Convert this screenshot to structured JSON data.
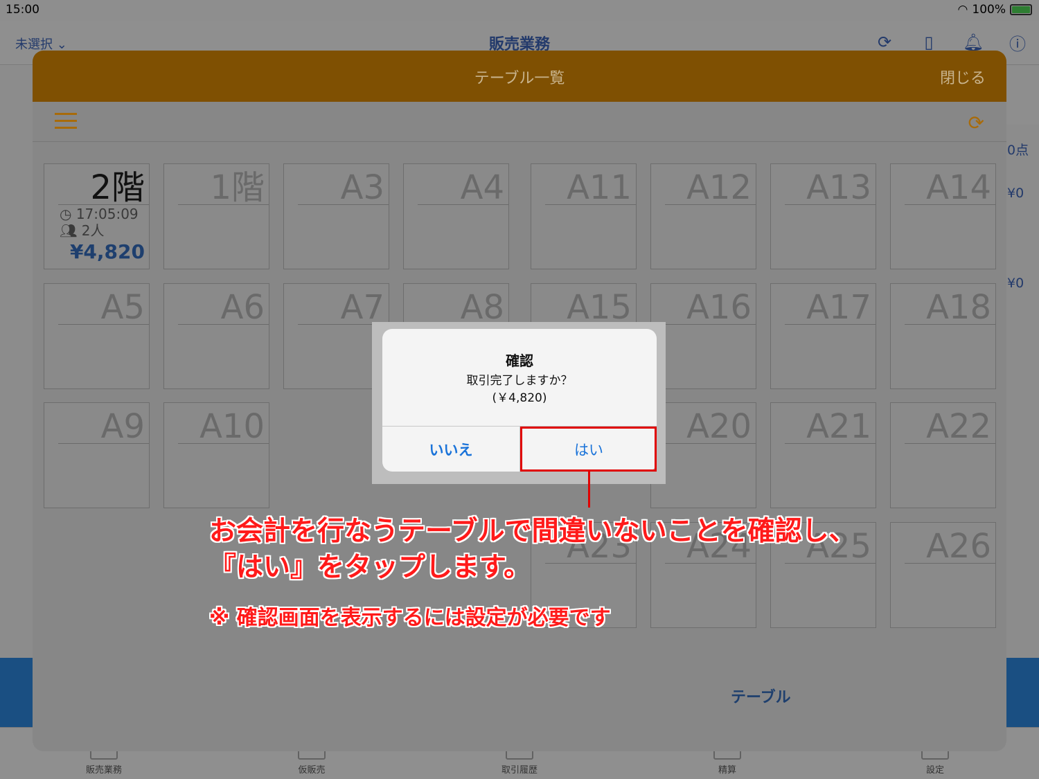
{
  "status": {
    "time": "15:00",
    "battery": "100%"
  },
  "navbar": {
    "left": "未選択",
    "title": "販売業務"
  },
  "side_right": [
    "0点",
    "¥0",
    "¥0"
  ],
  "sheet": {
    "title": "テーブル一覧",
    "close": "閉じる",
    "tables": [
      {
        "name": "2階",
        "active": true,
        "time": "17:05:09",
        "people": "2人",
        "amount": "¥4,820"
      },
      {
        "name": "1階"
      },
      {
        "name": "A3"
      },
      {
        "name": "A4"
      },
      {
        "name": "A11"
      },
      {
        "name": "A12"
      },
      {
        "name": "A13"
      },
      {
        "name": "A14"
      },
      {
        "name": "A5"
      },
      {
        "name": "A6"
      },
      {
        "name": "A7"
      },
      {
        "name": "A8"
      },
      {
        "name": "A15"
      },
      {
        "name": "A16"
      },
      {
        "name": "A17"
      },
      {
        "name": "A18"
      },
      {
        "name": "A9"
      },
      {
        "name": "A10"
      },
      {
        "name": ""
      },
      {
        "name": ""
      },
      {
        "name": ""
      },
      {
        "name": "A20"
      },
      {
        "name": "A21"
      },
      {
        "name": "A22"
      },
      {
        "name": ""
      },
      {
        "name": ""
      },
      {
        "name": ""
      },
      {
        "name": ""
      },
      {
        "name": "A23"
      },
      {
        "name": "A24"
      },
      {
        "name": "A25"
      },
      {
        "name": "A26"
      }
    ],
    "bottom_label": "テーブル"
  },
  "dialog": {
    "title": "確認",
    "message": "取引完了しますか？",
    "amount": "(￥4,820)",
    "no": "いいえ",
    "yes": "はい"
  },
  "annotation": {
    "line1": "お会計を行なうテーブルで間違いないことを確認し、",
    "line2": "『はい』をタップします。",
    "note": "※ 確認画面を表示するには設定が必要です"
  },
  "tabs": [
    "販売業務",
    "仮販売",
    "取引履歴",
    "精算",
    "設定"
  ]
}
